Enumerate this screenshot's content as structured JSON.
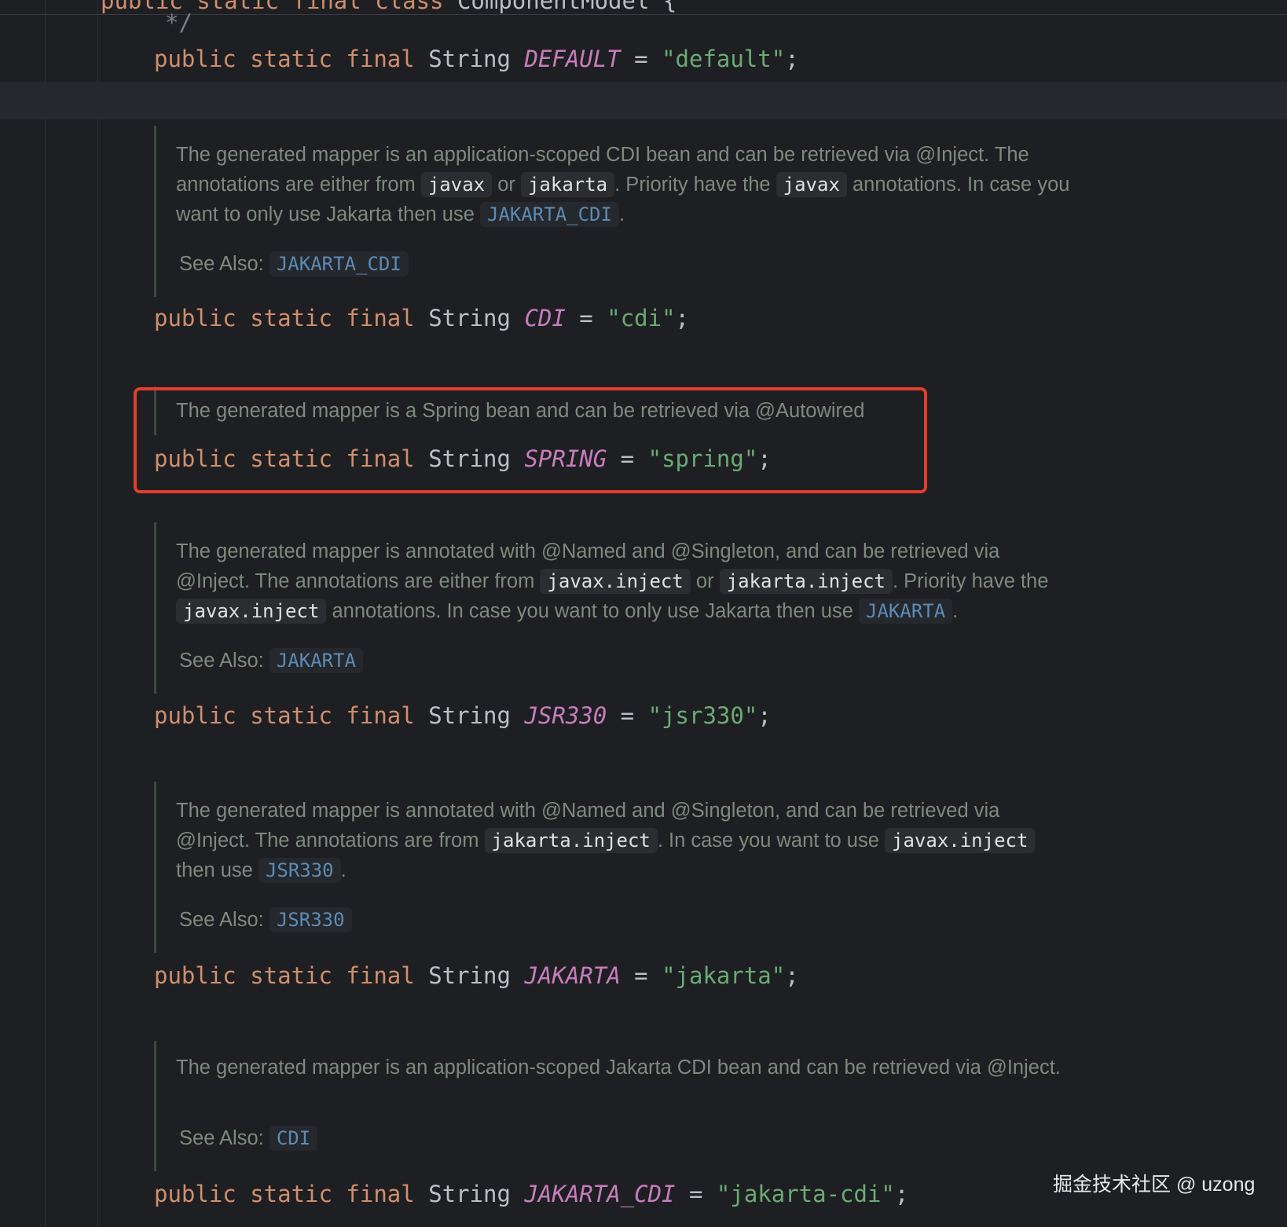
{
  "top_code": {
    "kw": "public static final class",
    "name": "ComponentModel {"
  },
  "comment_end": "*/",
  "fields": [
    {
      "name": "DEFAULT",
      "value": "\"default\""
    },
    {
      "name": "CDI",
      "value": "\"cdi\""
    },
    {
      "name": "SPRING",
      "value": "\"spring\""
    },
    {
      "name": "JSR330",
      "value": "\"jsr330\""
    },
    {
      "name": "JAKARTA",
      "value": "\"jakarta\""
    },
    {
      "name": "JAKARTA_CDI",
      "value": "\"jakarta-cdi\""
    }
  ],
  "code_tokens": {
    "kw": "public static final",
    "type": "String",
    "eq": "=",
    "semi": ";"
  },
  "docs": {
    "cdi": {
      "t1": "The generated mapper is an application-scoped CDI bean and can be retrieved via @Inject. The annotations are either from",
      "c1": "javax",
      "t2": "or",
      "c2": "jakarta",
      "t3": ". Priority have the",
      "c3": "javax",
      "t4": "annotations. In case you want to only use Jakarta then use",
      "l1": "JAKARTA_CDI",
      "t5": ".",
      "see_label": "See Also:",
      "see_link": "JAKARTA_CDI"
    },
    "spring": {
      "t1": "The generated mapper is a Spring bean and can be retrieved via @Autowired"
    },
    "jsr330": {
      "t1": "The generated mapper is annotated with @Named and @Singleton, and can be retrieved via @Inject. The annotations are either from",
      "c1": "javax.inject",
      "t2": "or",
      "c2": "jakarta.inject",
      "t3": ". Priority have the",
      "c3": "javax.inject",
      "t4": "annotations. In case you want to only use Jakarta then use",
      "l1": "JAKARTA",
      "t5": ".",
      "see_label": "See Also:",
      "see_link": "JAKARTA"
    },
    "jakarta": {
      "t1": "The generated mapper is annotated with @Named and @Singleton, and can be retrieved via @Inject. The annotations are from",
      "c1": "jakarta.inject",
      "t2": ". In case you want to use",
      "c2": "javax.inject",
      "t3": "then use",
      "l1": "JSR330",
      "t4": ".",
      "see_label": "See Also:",
      "see_link": "JSR330"
    },
    "jakarta_cdi": {
      "t1": "The generated mapper is an application-scoped Jakarta CDI bean and can be retrieved via @Inject.",
      "see_label": "See Also:",
      "see_link": "CDI"
    }
  },
  "watermark": "掘金技术社区 @ uzong"
}
